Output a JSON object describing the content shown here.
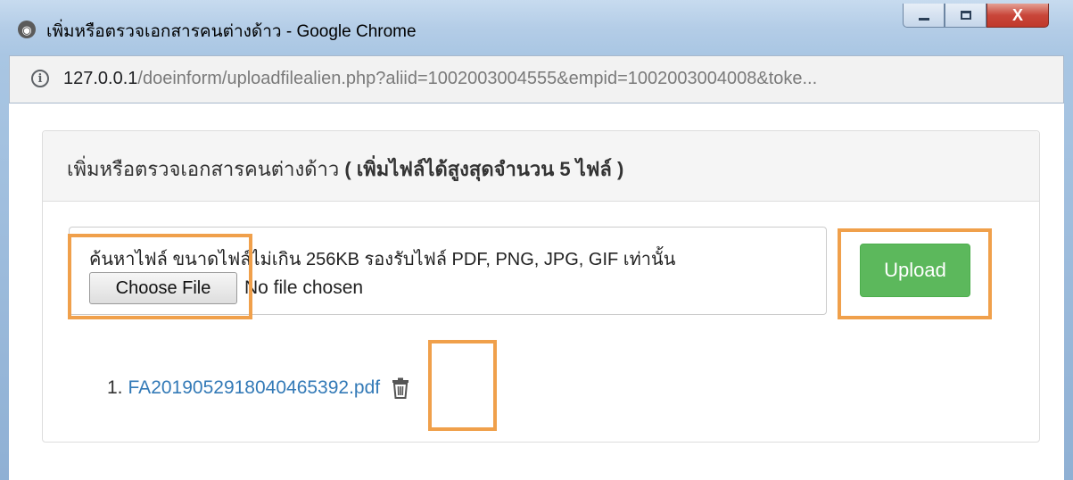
{
  "window": {
    "title": "เพิ่มหรือตรวจเอกสารคนต่างด้าว - Google Chrome",
    "controls": {
      "minimize": "minimize",
      "maximize": "maximize",
      "close": "X"
    }
  },
  "addressbar": {
    "host": "127.0.0.1",
    "path": "/doeinform/uploadfilealien.php?aliid=1002003004555&empid=1002003004008&toke..."
  },
  "panel": {
    "title": "เพิ่มหรือตรวจเอกสารคนต่างด้าว",
    "title_bold": "( เพิ่มไฟล์ได้สูงสุดจำนวน 5 ไฟล์ )"
  },
  "upload_form": {
    "hint": "ค้นหาไฟล์ ขนาดไฟล์ไม่เกิน 256KB รองรับไฟล์ PDF, PNG, JPG, GIF เท่านั้น",
    "choose_file_label": "Choose File",
    "no_file_text": "No file chosen",
    "upload_label": "Upload"
  },
  "files": [
    {
      "number": "1.",
      "name": "FA2019052918040465392.pdf"
    }
  ],
  "colors": {
    "upload_button": "#5cb85c",
    "link": "#337ab7",
    "highlight": "#f0a04b"
  },
  "icons": {
    "app": "chrome-globe-icon",
    "info": "info-icon",
    "delete": "trash-icon"
  }
}
